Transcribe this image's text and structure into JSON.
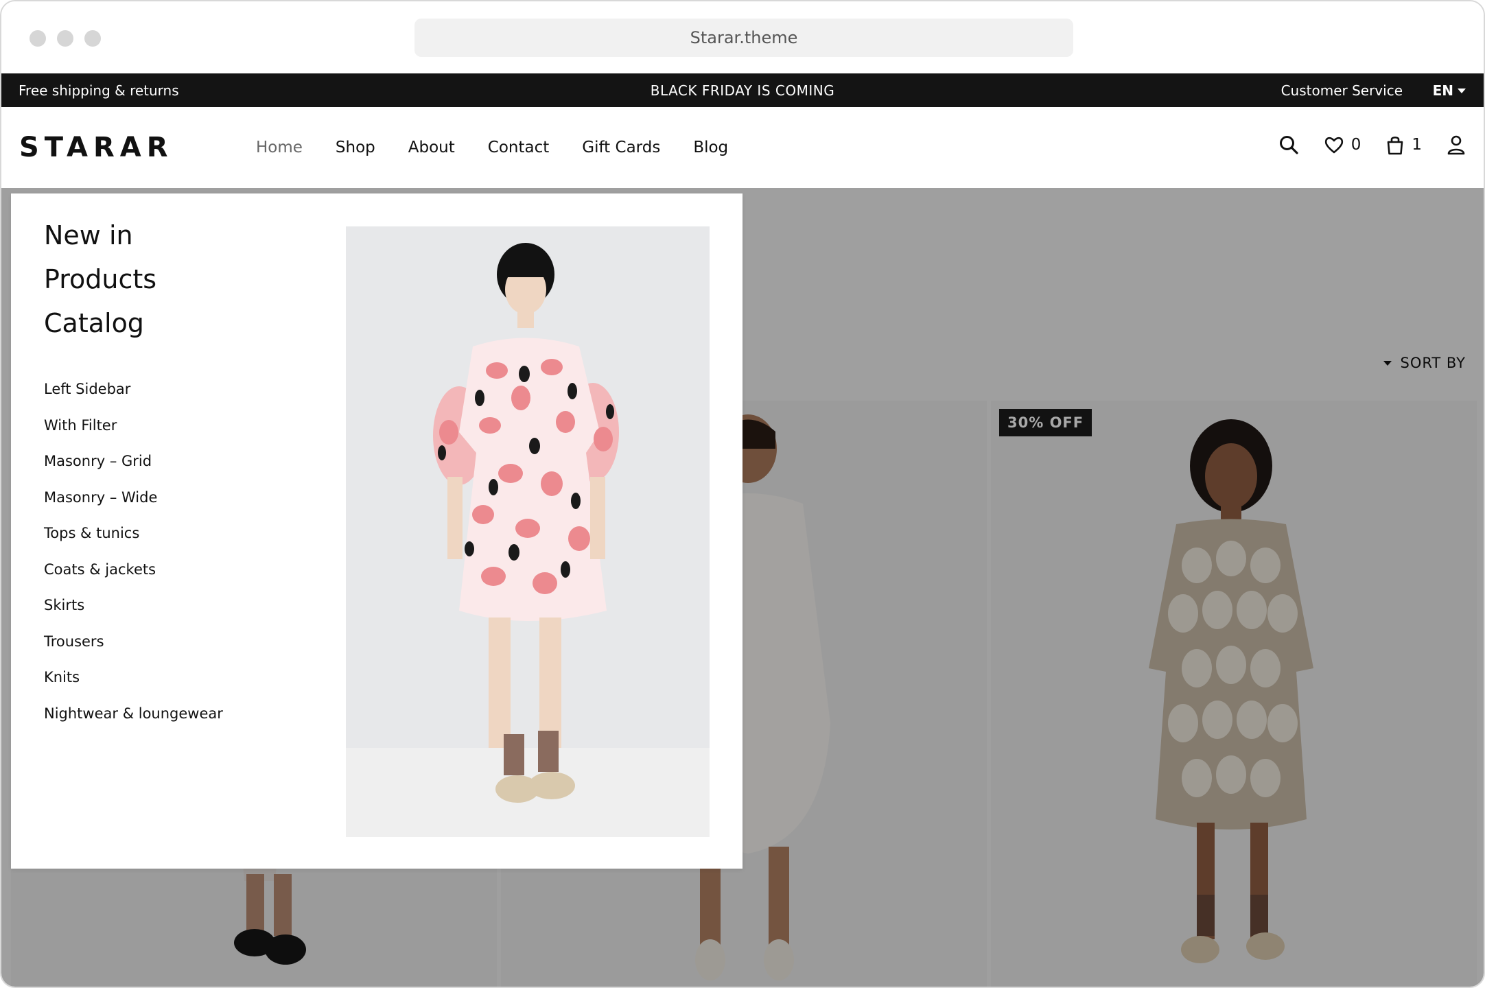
{
  "browser": {
    "url": "Starar.theme"
  },
  "topbar": {
    "left_text": "Free shipping & returns",
    "center_text": "BLACK FRIDAY IS COMING",
    "customer_service": "Customer Service",
    "language": "EN"
  },
  "header": {
    "logo": "STARAR",
    "nav": [
      "Home",
      "Shop",
      "About",
      "Contact",
      "Gift Cards",
      "Blog"
    ],
    "active_nav": "Home",
    "wishlist_count": "0",
    "cart_count": "1"
  },
  "shop": {
    "sort_label": "SORT BY",
    "badge": "30% OFF"
  },
  "mega_menu": {
    "primary": [
      "New in",
      "Products",
      "Catalog"
    ],
    "links": [
      "Left Sidebar",
      "With Filter",
      "Masonry – Grid",
      "Masonry – Wide",
      "Tops & tunics",
      "Coats & jackets",
      "Skirts",
      "Trousers",
      "Knits",
      "Nightwear & loungewear"
    ]
  },
  "colors": {
    "topbar_bg": "#141414",
    "overlay": "rgba(0,0,0,0.34)",
    "dress_pink": "#ec8a8f",
    "dress_beige": "#c9bba8"
  }
}
